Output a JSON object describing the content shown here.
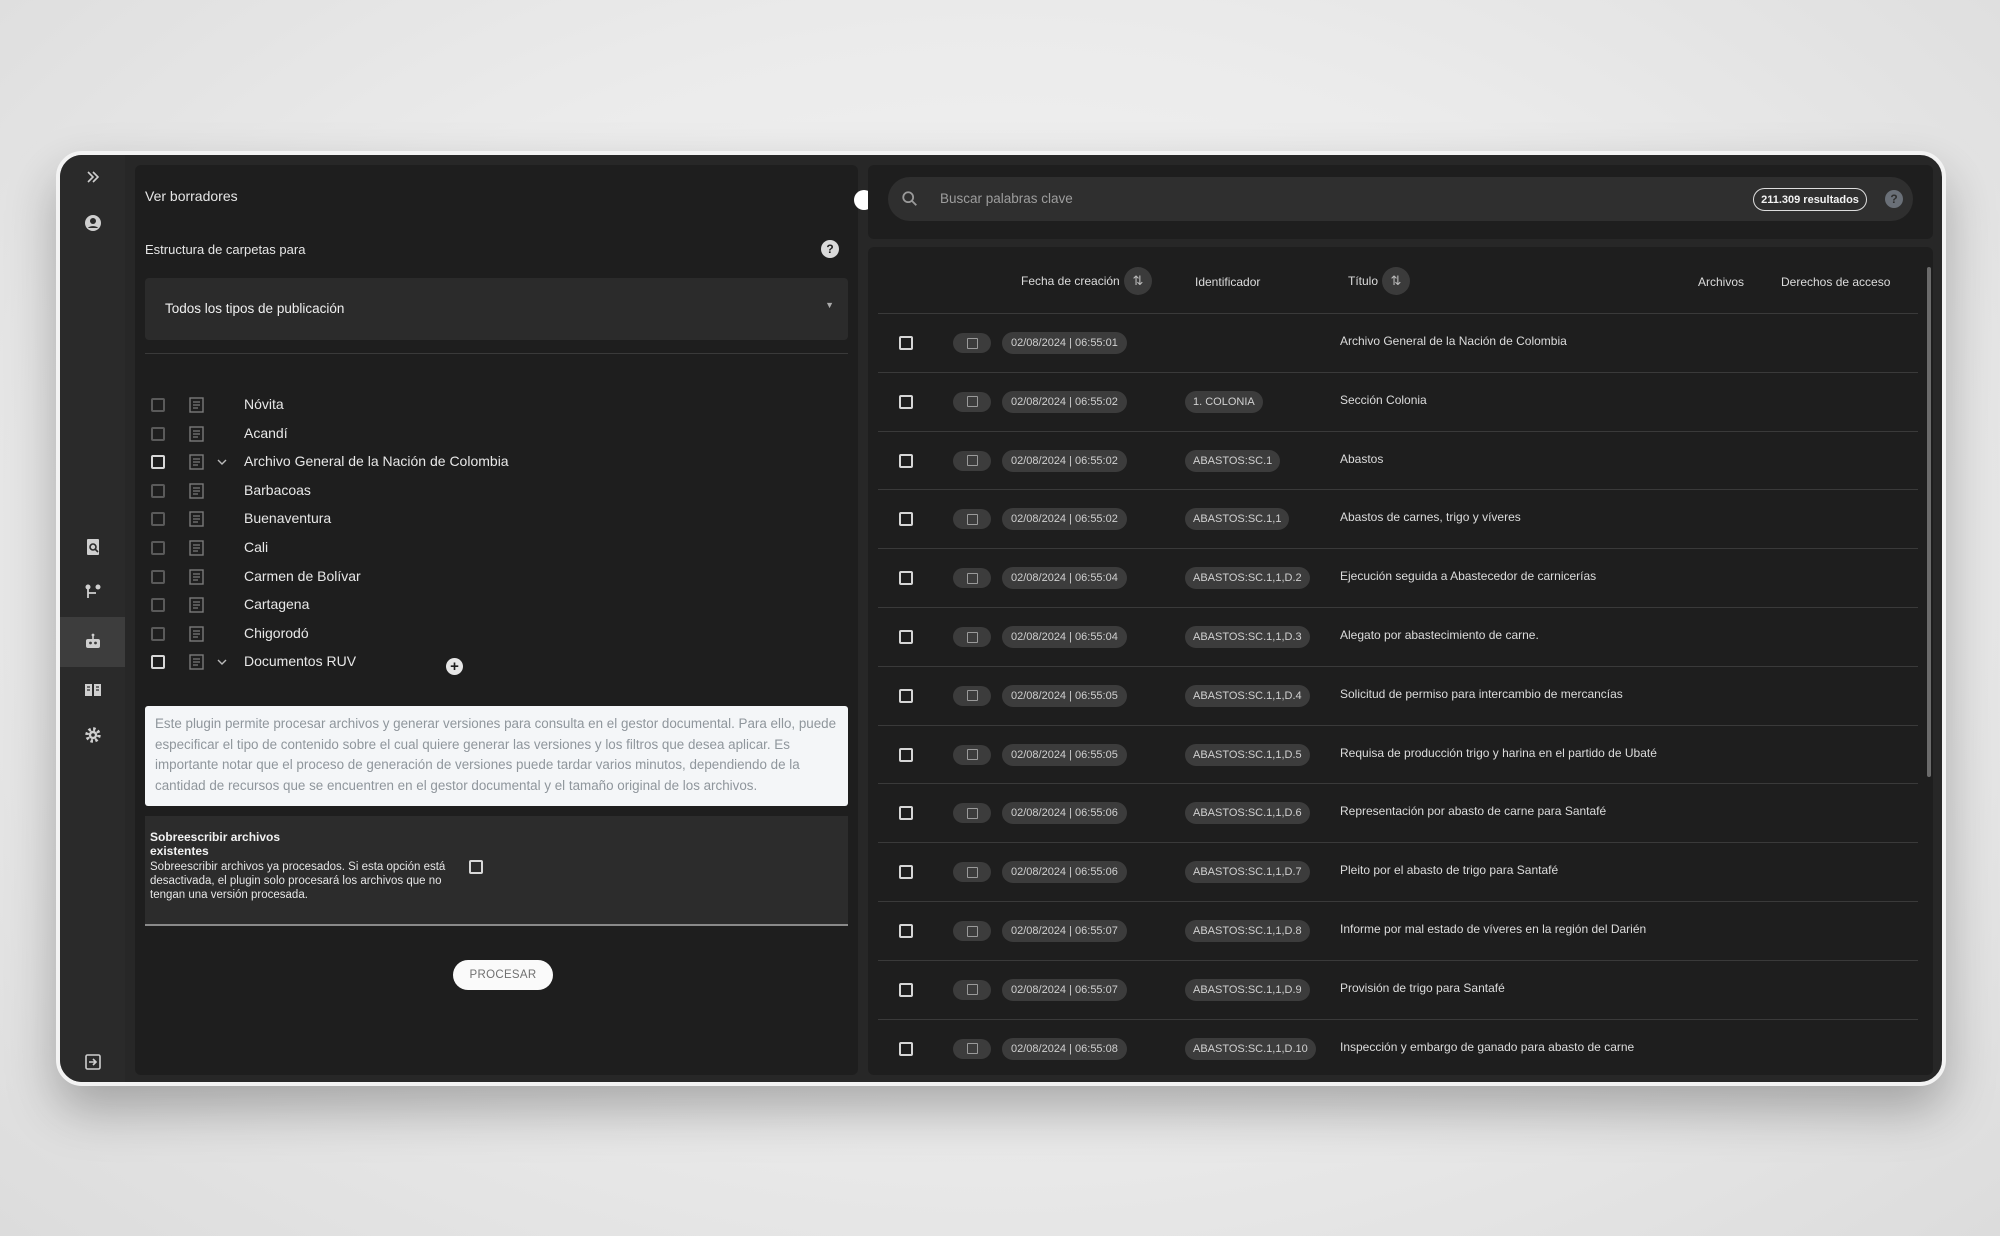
{
  "left": {
    "drafts_label": "Ver borradores",
    "structure_label": "Estructura de carpetas para",
    "select_value": "Todos los tipos de publicación",
    "tree": [
      {
        "label": "Nóvita",
        "expandable": false
      },
      {
        "label": "Acandí",
        "expandable": false
      },
      {
        "label": "Archivo General de la Nación de Colombia",
        "expandable": true
      },
      {
        "label": "Barbacoas",
        "expandable": false
      },
      {
        "label": "Buenaventura",
        "expandable": false
      },
      {
        "label": "Cali",
        "expandable": false
      },
      {
        "label": "Carmen de Bolívar",
        "expandable": false
      },
      {
        "label": "Cartagena",
        "expandable": false
      },
      {
        "label": "Chigorodó",
        "expandable": false
      },
      {
        "label": "Documentos RUV",
        "expandable": true
      }
    ],
    "note": "Este plugin permite procesar archivos y generar versiones para consulta en el gestor documental. Para ello, puede especificar el tipo de contenido sobre el cual quiere generar las versiones y los filtros que desea aplicar. Es importante notar que el proceso de generación de versiones puede tardar varios minutos, dependiendo de la cantidad de recursos que se encuentren en el gestor documental y el tamaño original de los archivos.",
    "overwrite_title": "Sobreescribir archivos existentes",
    "overwrite_desc": "Sobreescribir archivos ya procesados. Si esta opción está desactivada, el plugin solo procesará los archivos que no tengan una versión procesada.",
    "process_button": "PROCESAR"
  },
  "right": {
    "search_placeholder": "Buscar palabras clave",
    "results_badge": "211.309 resultados",
    "columns": {
      "fecha": "Fecha de creación",
      "identificador": "Identificador",
      "titulo": "Título",
      "archivos": "Archivos",
      "derechos": "Derechos de acceso"
    },
    "rows": [
      {
        "date": "02/08/2024 | 06:55:01",
        "id": "",
        "title": "Archivo General de la Nación de Colombia"
      },
      {
        "date": "02/08/2024 | 06:55:02",
        "id": "1. COLONIA",
        "title": "Sección Colonia"
      },
      {
        "date": "02/08/2024 | 06:55:02",
        "id": "ABASTOS:SC.1",
        "title": "Abastos"
      },
      {
        "date": "02/08/2024 | 06:55:02",
        "id": "ABASTOS:SC.1,1",
        "title": "Abastos de carnes, trigo y víveres"
      },
      {
        "date": "02/08/2024 | 06:55:04",
        "id": "ABASTOS:SC.1,1,D.2",
        "title": "Ejecución seguida a Abastecedor de carnicerías"
      },
      {
        "date": "02/08/2024 | 06:55:04",
        "id": "ABASTOS:SC.1,1,D.3",
        "title": "Alegato por abastecimiento de carne."
      },
      {
        "date": "02/08/2024 | 06:55:05",
        "id": "ABASTOS:SC.1,1,D.4",
        "title": "Solicitud de permiso para intercambio de mercancías"
      },
      {
        "date": "02/08/2024 | 06:55:05",
        "id": "ABASTOS:SC.1,1,D.5",
        "title": "Requisa de producción trigo y harina en el partido de Ubaté"
      },
      {
        "date": "02/08/2024 | 06:55:06",
        "id": "ABASTOS:SC.1,1,D.6",
        "title": "Representación por abasto de carne para Santafé"
      },
      {
        "date": "02/08/2024 | 06:55:06",
        "id": "ABASTOS:SC.1,1,D.7",
        "title": "Pleito por el abasto de trigo para Santafé"
      },
      {
        "date": "02/08/2024 | 06:55:07",
        "id": "ABASTOS:SC.1,1,D.8",
        "title": "Informe por mal estado de víveres en la región del Darién"
      },
      {
        "date": "02/08/2024 | 06:55:07",
        "id": "ABASTOS:SC.1,1,D.9",
        "title": "Provisión de trigo para Santafé"
      },
      {
        "date": "02/08/2024 | 06:55:08",
        "id": "ABASTOS:SC.1,1,D.10",
        "title": "Inspección y embargo de ganado para abasto de carne"
      }
    ]
  }
}
